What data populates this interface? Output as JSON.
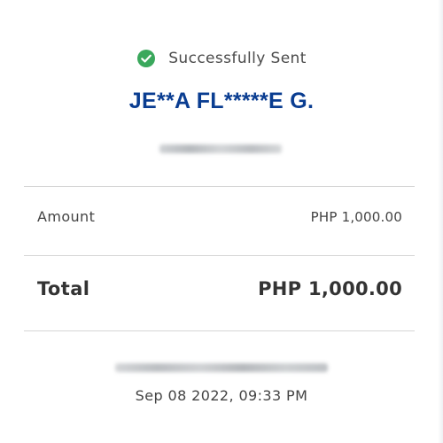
{
  "status": {
    "icon": "check-circle-icon",
    "text": "Successfully Sent",
    "icon_color": "#3aa85c"
  },
  "recipient": {
    "name": "JE**A FL*****E G.",
    "color": "#0a3d91"
  },
  "amount_row": {
    "label": "Amount",
    "value": "PHP 1,000.00"
  },
  "total_row": {
    "label": "Total",
    "value": "PHP 1,000.00"
  },
  "transaction": {
    "datetime": "Sep 08 2022, 09:33 PM"
  }
}
